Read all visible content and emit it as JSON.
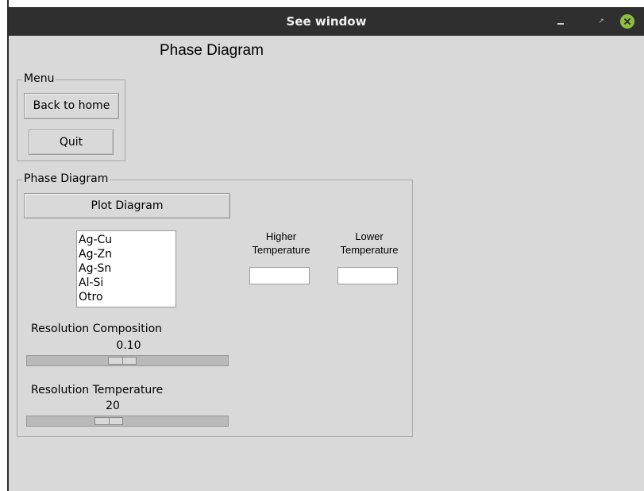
{
  "window": {
    "title": "See window"
  },
  "heading": "Phase Diagram",
  "menu": {
    "legend": "Menu",
    "back_label": "Back to home",
    "quit_label": "Quit"
  },
  "phase": {
    "legend": "Phase Diagram",
    "plot_label": "Plot Diagram",
    "list": [
      "Ag-Cu",
      "Ag-Zn",
      "Ag-Sn",
      "Al-Si",
      "Otro"
    ],
    "higher_label_1": "Higher",
    "higher_label_2": "Temperature",
    "lower_label_1": "Lower",
    "lower_label_2": "Temperature",
    "higher_value": "",
    "lower_value": "",
    "res_comp_label": "Resolution Composition",
    "res_comp_value": "0.10",
    "res_comp_fraction": 0.47,
    "res_temp_label": "Resolution Temperature",
    "res_temp_value": "20",
    "res_temp_fraction": 0.39
  }
}
